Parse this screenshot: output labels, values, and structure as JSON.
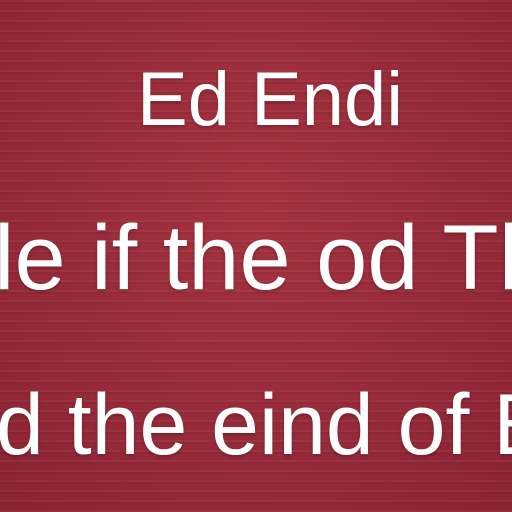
{
  "lines": [
    {
      "text": "Ed Endi"
    },
    {
      "text": "le if the od Th"
    },
    {
      "text": "d the eind of Eho"
    }
  ],
  "colors": {
    "background": "#9a2c3c",
    "text": "#ffffff"
  }
}
